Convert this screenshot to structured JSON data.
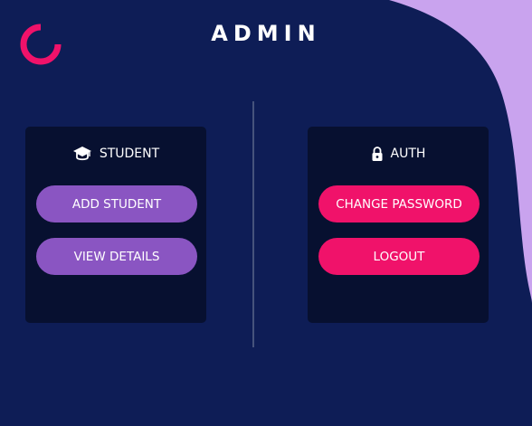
{
  "colors": {
    "background": "#0e1d56",
    "card": "#071030",
    "accent_purple": "#8a55c2",
    "accent_pink": "#f0126a",
    "blob": "#c9a3ee",
    "divider": "#46537c"
  },
  "header": {
    "title": "ADMIN",
    "logo_icon": "spinner-ring-icon"
  },
  "student_card": {
    "icon": "graduation-cap-icon",
    "title": "STUDENT",
    "buttons": [
      {
        "label": "ADD STUDENT"
      },
      {
        "label": "VIEW DETAILS"
      }
    ]
  },
  "auth_card": {
    "icon": "padlock-icon",
    "title": "AUTH",
    "buttons": [
      {
        "label": "CHANGE PASSWORD"
      },
      {
        "label": "LOGOUT"
      }
    ]
  }
}
